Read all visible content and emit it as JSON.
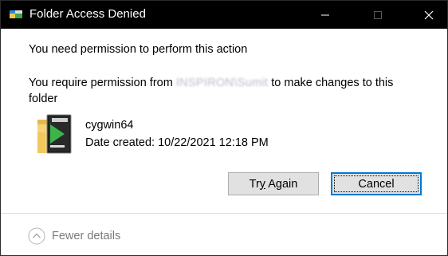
{
  "window": {
    "title": "Folder Access Denied",
    "icon": "folder-permission-icon"
  },
  "controls": {
    "minimize": "minimize-icon",
    "maximize": "maximize-icon",
    "close": "close-icon"
  },
  "message": {
    "heading": "You need permission to perform this action",
    "prefix": "You require permission from ",
    "principal": "INSPIRON\\Sumit",
    "suffix": " to make changes to this folder"
  },
  "item": {
    "name": "cygwin64",
    "date_created": "Date created: 10/22/2021 12:18 PM",
    "icon": "cygwin-folder-icon"
  },
  "buttons": {
    "try_again_pre": "Tr",
    "try_again_mnemonic": "y",
    "try_again_post": " Again",
    "cancel": "Cancel"
  },
  "footer": {
    "details_toggle": "Fewer details",
    "details_icon": "chevron-up-icon"
  },
  "colors": {
    "titlebar": "#000000",
    "accent": "#0078d7",
    "button_bg": "#e1e1e1",
    "muted_text": "#7a7a7a"
  }
}
